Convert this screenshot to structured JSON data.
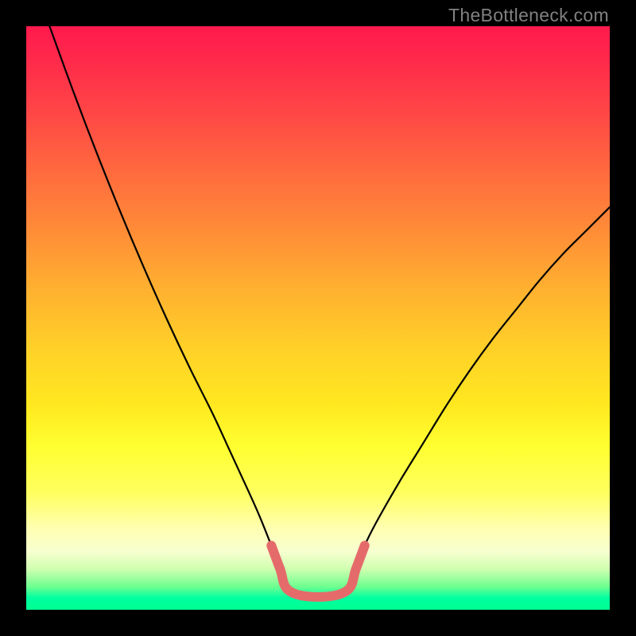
{
  "attribution": "TheBottleneck.com",
  "colors": {
    "page_bg": "#000000",
    "curve": "#000000",
    "highlight": "#e56b6b",
    "gradient_top": "#ff1a4d",
    "gradient_bottom": "#00ff90"
  },
  "chart_data": {
    "type": "line",
    "title": "",
    "xlabel": "",
    "ylabel": "",
    "xlim": [
      0,
      100
    ],
    "ylim": [
      0,
      100
    ],
    "grid": false,
    "legend": false,
    "series": [
      {
        "name": "bottleneck-curve",
        "x": [
          4,
          8,
          12,
          16,
          20,
          24,
          28,
          32,
          35,
          38,
          40,
          42,
          43.5,
          45,
          50,
          55,
          56.5,
          58,
          60,
          64,
          68,
          72,
          76,
          80,
          84,
          88,
          92,
          96,
          100
        ],
        "y": [
          100,
          89,
          78.5,
          68.5,
          59,
          50,
          41.5,
          33.5,
          27,
          20.5,
          16,
          11,
          7,
          3.3,
          2.2,
          3.3,
          7,
          11,
          15,
          22,
          28.5,
          35,
          41,
          46.5,
          51.5,
          56.5,
          61,
          65,
          69
        ]
      }
    ],
    "highlight_segment": {
      "x": [
        42,
        43.5,
        45,
        50,
        55,
        56.5,
        58
      ],
      "y": [
        11,
        7,
        3.3,
        2.2,
        3.3,
        7,
        11
      ]
    }
  }
}
